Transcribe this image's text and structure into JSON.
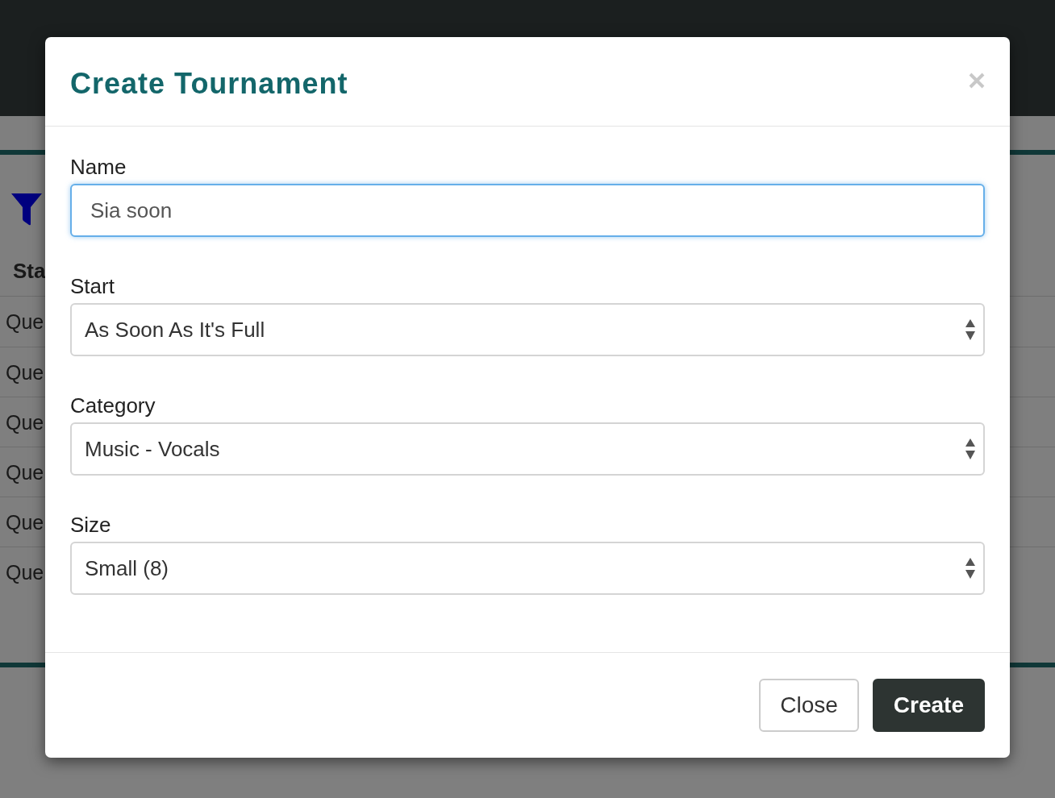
{
  "background": {
    "table": {
      "header": "Sta",
      "rows": [
        "Que",
        "Que",
        "Que",
        "Que",
        "Que",
        "Que"
      ]
    }
  },
  "dialog": {
    "title": "Create Tournament",
    "fields": [
      {
        "kind": "text",
        "label": "Name",
        "value": "Sia soon",
        "focused": true
      },
      {
        "kind": "select",
        "label": "Start",
        "value": "As Soon As It's Full",
        "focused": false
      },
      {
        "kind": "select",
        "label": "Category",
        "value": "Music - Vocals",
        "focused": false
      },
      {
        "kind": "select",
        "label": "Size",
        "value": "Small (8)",
        "focused": false
      }
    ],
    "buttons": [
      {
        "kind": "secondary",
        "label": "Close"
      },
      {
        "kind": "primary",
        "label": "Create"
      }
    ]
  }
}
